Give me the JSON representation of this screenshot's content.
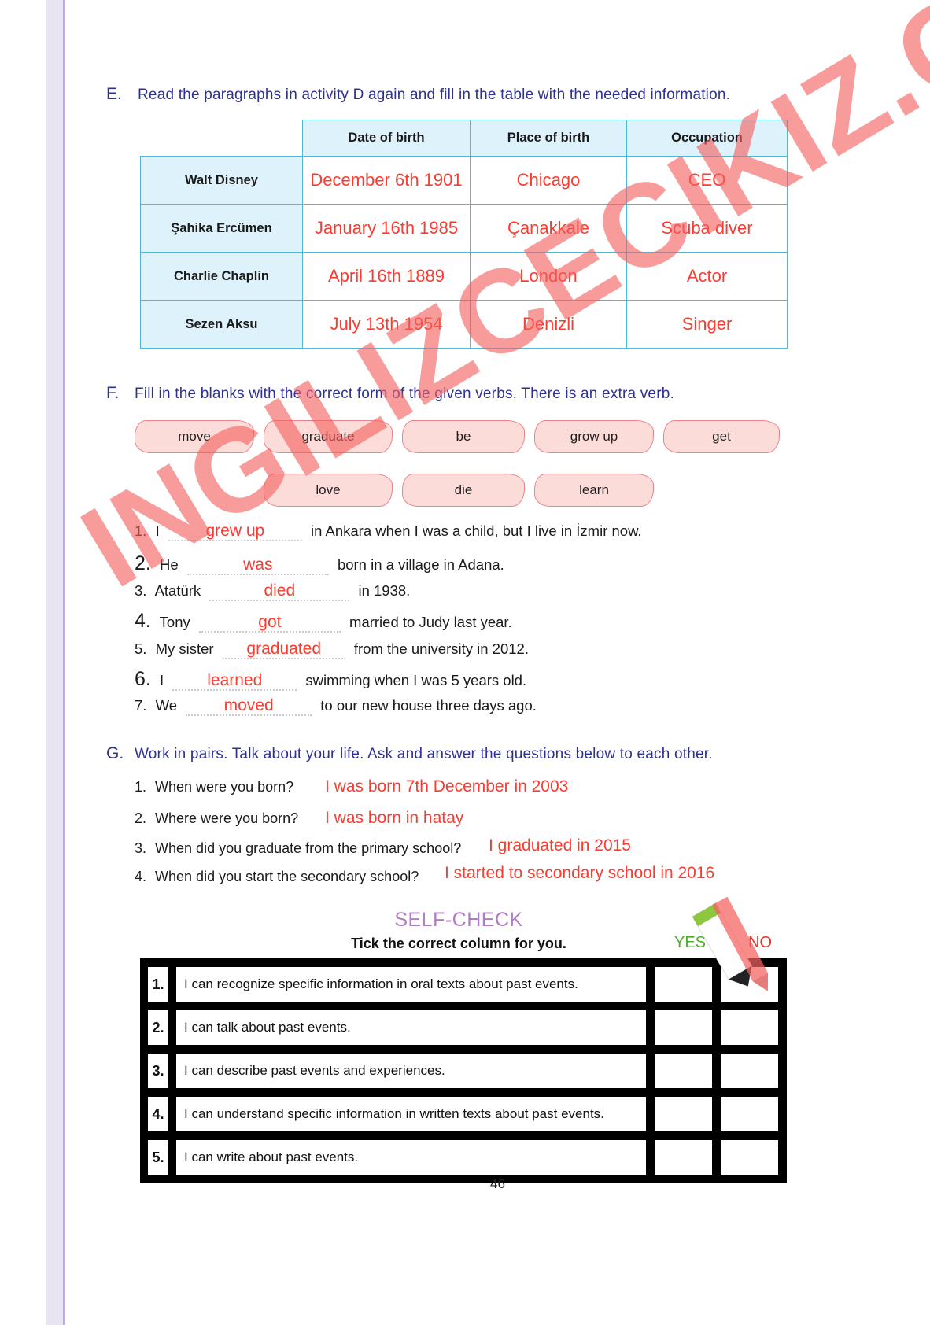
{
  "watermark": {
    "text": "INGILIZCECIKIZ.COM"
  },
  "sections": {
    "e": {
      "letter": "E.",
      "instruction": "Read the paragraphs in activity D again and fill in the table with the needed information.",
      "table": {
        "headers": [
          "",
          "Date of birth",
          "Place of birth",
          "Occupation"
        ],
        "rows": [
          {
            "name": "Walt Disney",
            "date": "December 6th 1901",
            "place": "Chicago",
            "occupation": "CEO"
          },
          {
            "name": "Şahika Ercümen",
            "date": "January 16th 1985",
            "place": "Çanakkale",
            "occupation": "Scuba diver"
          },
          {
            "name": "Charlie Chaplin",
            "date": "April 16th  1889",
            "place": "London",
            "occupation": "Actor"
          },
          {
            "name": "Sezen Aksu",
            "date": "July 13th 1954",
            "place": "Denizli",
            "occupation": "Singer"
          }
        ]
      }
    },
    "f": {
      "letter": "F.",
      "instruction": "Fill in the blanks with the correct form of the given verbs. There is an extra verb.",
      "word_bank_row1": [
        "move",
        "graduate",
        "be",
        "grow up",
        "get"
      ],
      "word_bank_row2": [
        "love",
        "die",
        "learn"
      ],
      "items": [
        {
          "num": "1.",
          "before": "I",
          "answer": "grew up",
          "after": "in Ankara when I was a child, but I live in İzmir now."
        },
        {
          "num": "2.",
          "before": "He",
          "answer": "was",
          "after": "born in a village in Adana."
        },
        {
          "num": "3.",
          "before": "Atatürk",
          "answer": "died",
          "after": "in 1938."
        },
        {
          "num": "4.",
          "before": "Tony",
          "answer": "got",
          "after": "married to Judy last year."
        },
        {
          "num": "5.",
          "before": "My sister",
          "answer": "graduated",
          "after": "from the university in 2012."
        },
        {
          "num": "6.",
          "before": "I",
          "answer": "learned",
          "after": "swimming when I was 5 years old."
        },
        {
          "num": "7.",
          "before": "We",
          "answer": "moved",
          "after": "to our new house three days ago."
        }
      ]
    },
    "g": {
      "letter": "G.",
      "instruction": "Work in pairs. Talk about your life. Ask and answer the questions below to each other.",
      "items": [
        {
          "num": "1.",
          "question": "When were you born?",
          "answer": "I was born 7th December in 2003"
        },
        {
          "num": "2.",
          "question": "Where were you born?",
          "answer": "I was born in hatay"
        },
        {
          "num": "3.",
          "question": "When did you graduate from the primary school?",
          "answer": "I graduated in 2015"
        },
        {
          "num": "4.",
          "question": "When did you start the secondary school?",
          "answer": "I started to secondary school in 2016"
        }
      ]
    },
    "self_check": {
      "title": "SELF-CHECK",
      "subtitle": "Tick the correct column for you.",
      "yes_label": "YES",
      "no_label": "NO",
      "rows": [
        {
          "num": "1.",
          "text": "I can recognize specific information in oral texts about past events."
        },
        {
          "num": "2.",
          "text": "I can talk about past events."
        },
        {
          "num": "3.",
          "text": "I can describe past events and experiences."
        },
        {
          "num": "4.",
          "text": "I can understand specific information in written texts about past events."
        },
        {
          "num": "5.",
          "text": "I can write about past events."
        }
      ]
    }
  },
  "page_number": "46"
}
